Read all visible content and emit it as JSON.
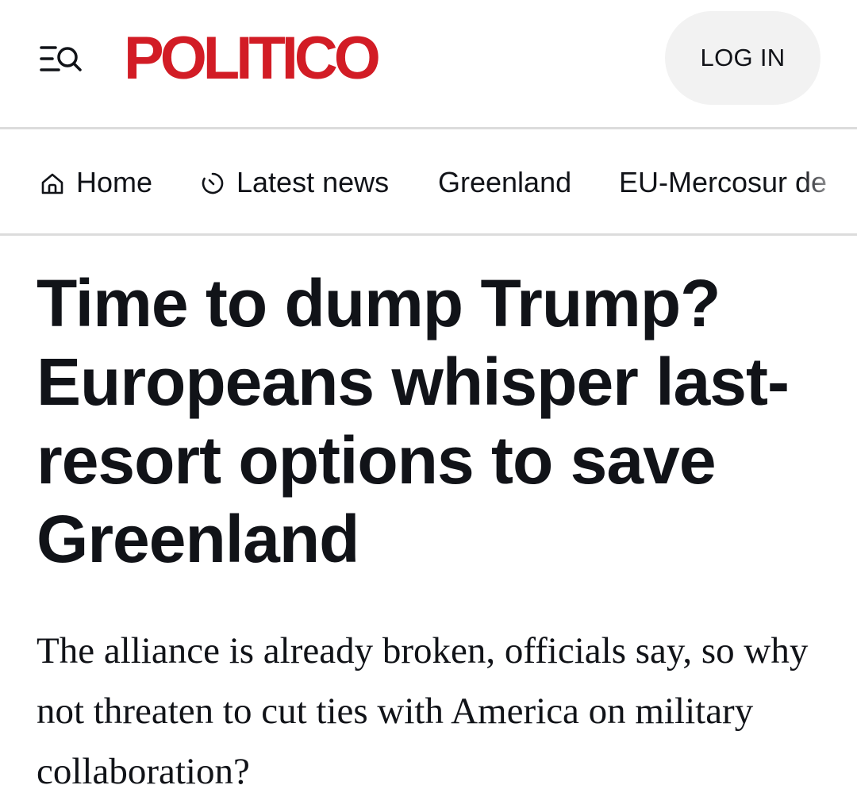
{
  "header": {
    "logo_text": "POLITICO",
    "login_label": "LOG IN",
    "menu_icon": "menu-search-icon",
    "logo_color": "#d21c25"
  },
  "nav": {
    "items": [
      {
        "label": "Home",
        "icon": "home-icon"
      },
      {
        "label": "Latest news",
        "icon": "clock-icon"
      },
      {
        "label": "Greenland"
      },
      {
        "label": "EU-Mercosur de"
      }
    ]
  },
  "article": {
    "headline": "Time to dump Trump? Europeans whisper last-resort options to save Greenland",
    "dek": "The alliance is already broken, officials say, so why not threaten to cut ties with America on military collaboration?"
  }
}
